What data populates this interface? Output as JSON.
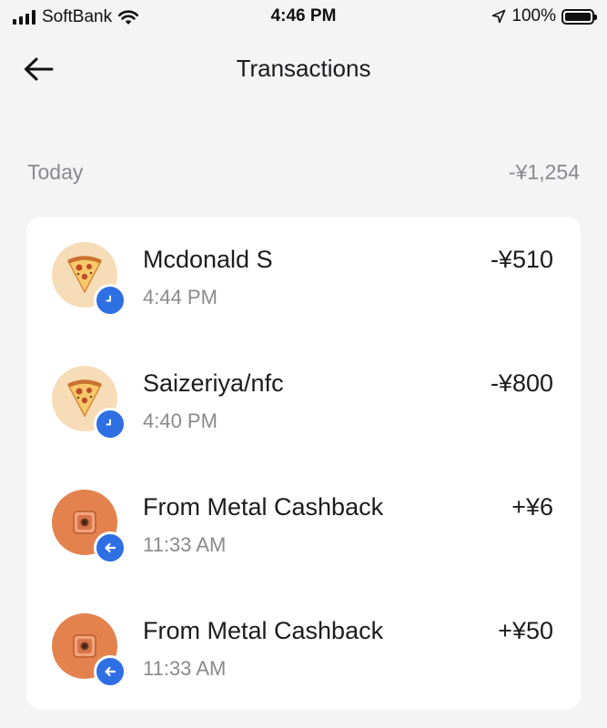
{
  "status_bar": {
    "carrier": "SoftBank",
    "time": "4:46 PM",
    "battery": "100%"
  },
  "header": {
    "title": "Transactions"
  },
  "section": {
    "label": "Today",
    "total": "-¥1,254"
  },
  "transactions": [
    {
      "merchant": "Mcdonald S",
      "time": "4:44 PM",
      "amount": "-¥510",
      "icon": "pizza-icon",
      "badge": "clock-icon"
    },
    {
      "merchant": "Saizeriya/nfc",
      "time": "4:40 PM",
      "amount": "-¥800",
      "icon": "pizza-icon",
      "badge": "clock-icon"
    },
    {
      "merchant": "From Metal Cashback",
      "time": "11:33 AM",
      "amount": "+¥6",
      "icon": "safe-icon",
      "badge": "arrow-left-icon"
    },
    {
      "merchant": "From Metal Cashback",
      "time": "11:33 AM",
      "amount": "+¥50",
      "icon": "safe-icon",
      "badge": "arrow-left-icon"
    }
  ],
  "colors": {
    "background": "#f4f4f5",
    "card": "#ffffff",
    "badge": "#2f6fe4",
    "muted_text": "#8a8a8e",
    "pizza_avatar": "#f7dcb8",
    "cashback_avatar": "#e4824e"
  }
}
